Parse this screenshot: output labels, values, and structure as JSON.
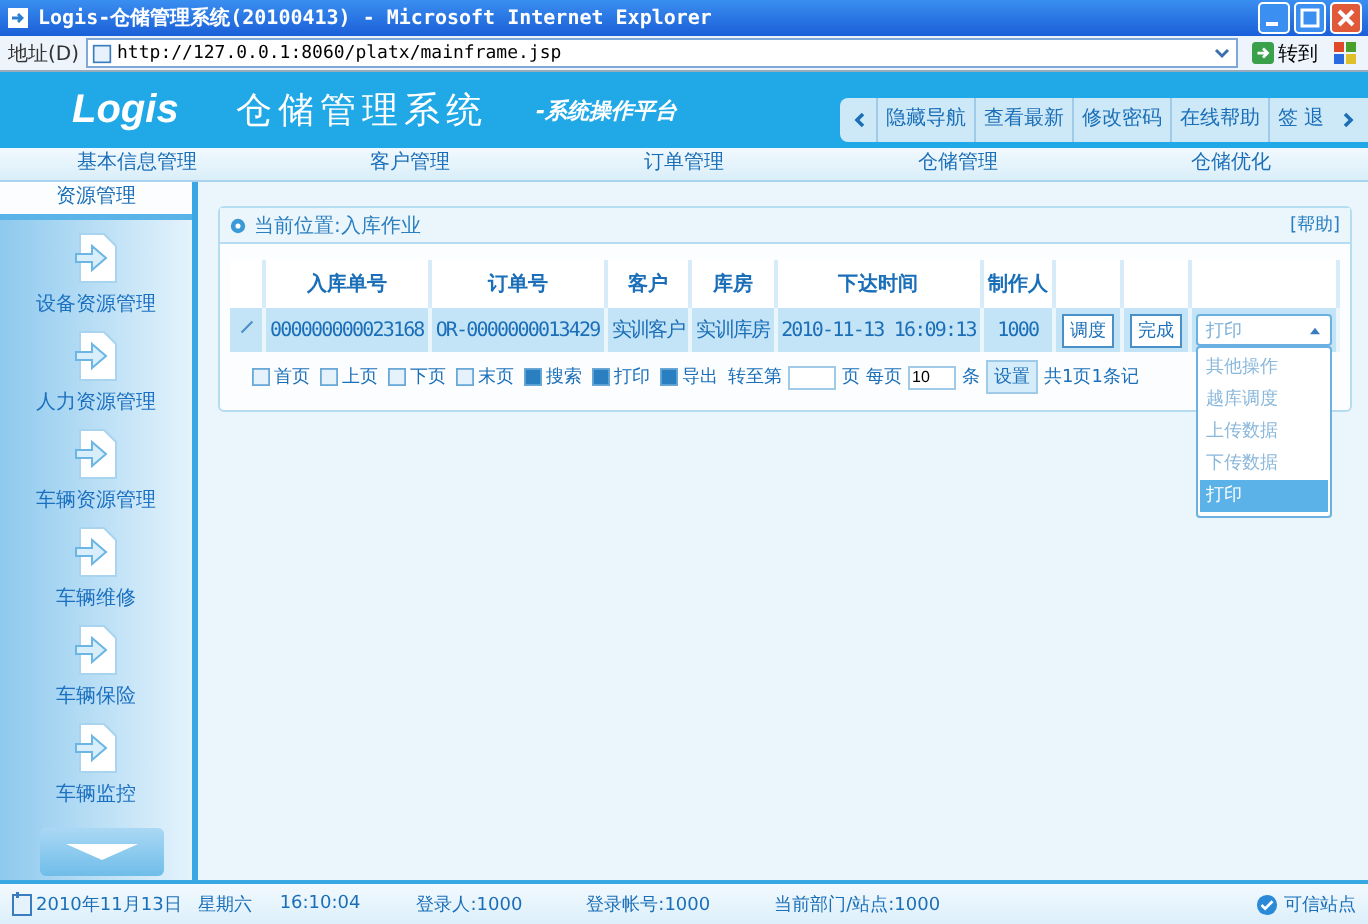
{
  "window": {
    "title": "Logis-仓储管理系统(20100413) - Microsoft Internet Explorer"
  },
  "address": {
    "label": "地址(D)",
    "url": "http://127.0.0.1:8060/platx/mainframe.jsp",
    "go": "转到"
  },
  "header": {
    "logo": "Logis",
    "title": "仓储管理系统",
    "subtitle": "-系统操作平台",
    "links": [
      "隐藏导航",
      "查看最新",
      "修改密码",
      "在线帮助",
      "签 退"
    ]
  },
  "nav": [
    "基本信息管理",
    "客户管理",
    "订单管理",
    "仓储管理",
    "仓储优化"
  ],
  "sidebar": {
    "title": "资源管理",
    "items": [
      "设备资源管理",
      "人力资源管理",
      "车辆资源管理",
      "车辆维修",
      "车辆保险",
      "车辆监控"
    ]
  },
  "panel": {
    "breadcrumb": "当前位置:入库作业",
    "help": "[帮助]"
  },
  "table": {
    "columns": [
      "入库单号",
      "订单号",
      "客户",
      "库房",
      "下达时间",
      "制作人"
    ],
    "rows": [
      {
        "cells": [
          "000000000023168",
          "OR-0000000013429",
          "实训客户",
          "实训库房",
          "2010-11-13 16:09:13",
          "1000"
        ],
        "buttons": [
          "调度",
          "完成"
        ],
        "select": {
          "value": "打印",
          "expanded": true,
          "options": [
            {
              "label": "其他操作",
              "selected": false
            },
            {
              "label": "越库调度",
              "selected": false
            },
            {
              "label": "上传数据",
              "selected": false
            },
            {
              "label": "下传数据",
              "selected": false
            },
            {
              "label": "打印",
              "selected": true
            }
          ]
        }
      }
    ]
  },
  "pager": {
    "links": [
      "首页",
      "上页",
      "下页",
      "末页",
      "搜索",
      "打印",
      "导出"
    ],
    "goto_label": "转至第",
    "page_unit": "页",
    "per_page_label": "每页",
    "per_page": "10",
    "per_unit": "条",
    "apply": "设置",
    "summary": "共1页1条记"
  },
  "status_bar": {
    "date": "2010年11月13日",
    "weekday": "星期六",
    "time": "16:10:04",
    "user": "登录人:1000",
    "account": "登录帐号:1000",
    "site": "当前部门/站点:1000",
    "zone": "可信站点"
  }
}
